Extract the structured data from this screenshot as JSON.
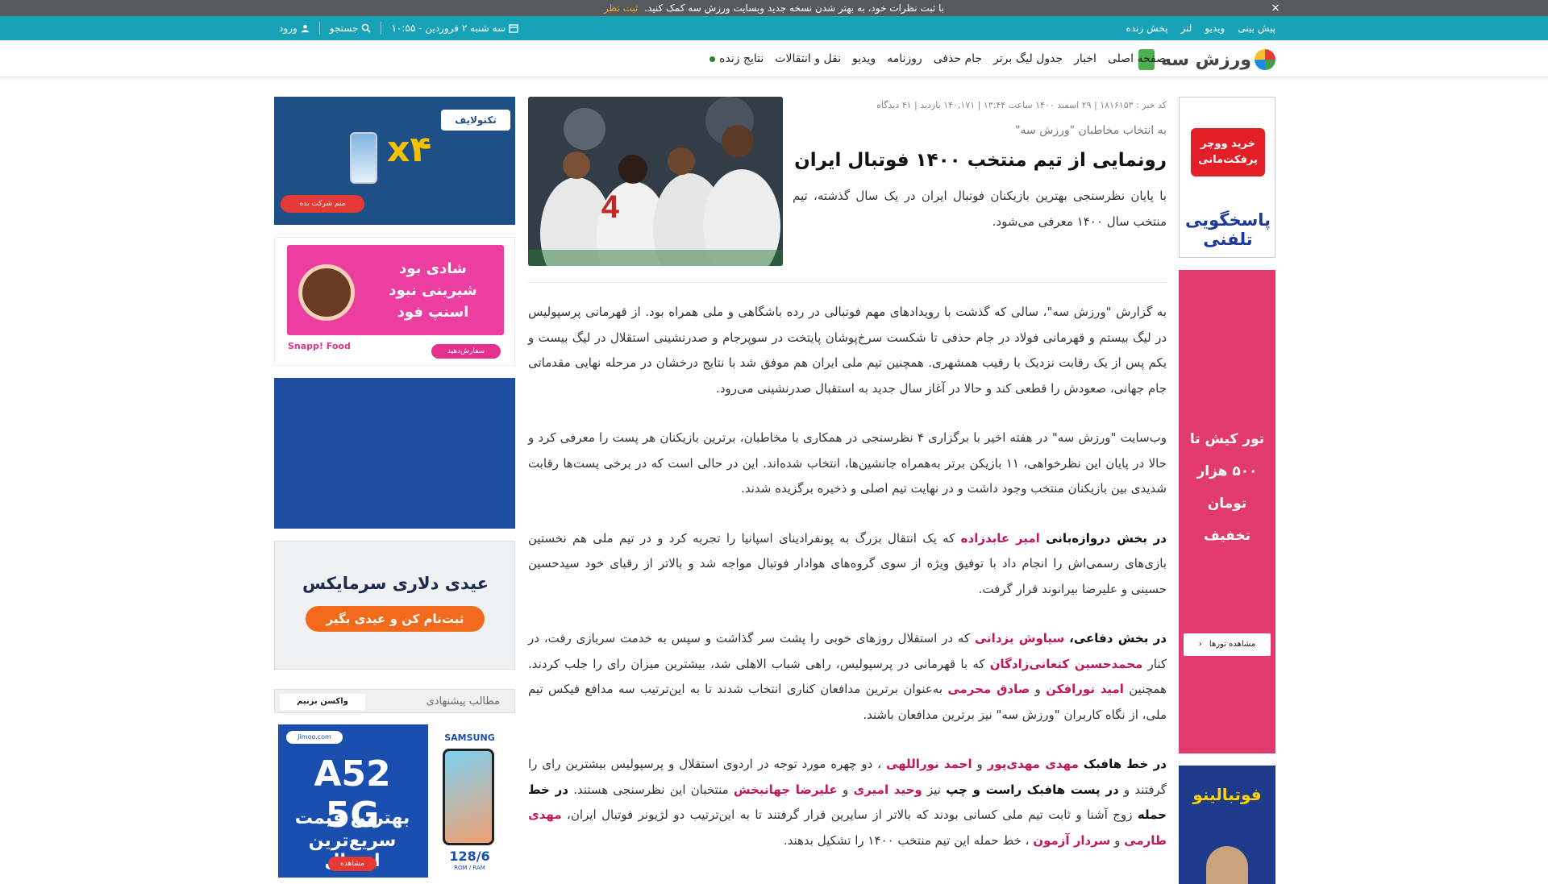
{
  "notice": {
    "text": "با ثبت نظرات خود، به بهتر شدن نسخه جدید وبسایت ورزش سه کمک کنید.",
    "link": "ثبت نظر",
    "close": "×"
  },
  "topbar": {
    "links": [
      "پیش بینی",
      "ویدیو",
      "لنز",
      "پخش زنده"
    ],
    "date": "سه شنبه ۲ فروردین - ۱۰:۵۵",
    "search": "جستجو",
    "login": "ورود"
  },
  "nav": {
    "logo": "ورزش سه",
    "items": [
      "صفحه اصلی",
      "اخبار",
      "جدول لیگ برتر",
      "جام حذفی",
      "روزنامه",
      "ویدیو",
      "نقل و انتقالات",
      "نتایج زنده"
    ]
  },
  "article": {
    "meta": "کد خبر : ۱۸۱۶۱۵۳ | ۲۹ اسفند ۱۴۰۰ ساعت ۱۳:۴۴ | ۱۴۰,۱۷۱ بازدید | ۴۱ دیدگاه",
    "kicker": "به انتخاب مخاطبان \"ورزش سه\"",
    "title": "رونمایی از تیم منتخب ۱۴۰۰ فوتبال ایران",
    "lead": "با پایان نظرسنجی بهترین بازیکنان فوتبال ایران در یک سال گذشته، تیم منتخب سال ۱۴۰۰ معرفی می‌شود.",
    "p1": "به گزارش \"ورزش سه\"، سالی که گذشت با رویدادهای مهم فوتبالی در رده باشگاهی و ملی همراه بود. از قهرمانی پرسپولیس در لیگ بیستم و قهرمانی فولاد در جام حذفی تا شکست سرخ‌پوشان پایتخت در سوپرجام و صدرنشینی استقلال در لیگ بیست و یکم پس از یک رقابت نزدیک با رقیب همشهری. همچنین تیم ملی ایران هم موفق شد با نتایج درخشان در مرحله نهایی مقدماتی جام جهانی، صعودش را قطعی کند و حالا در آغاز سال جدید به استقبال صدرنشینی می‌رود.",
    "p2": "وب‌سایت \"ورزش سه\" در هفته اخیر با برگزاری ۴ نظرسنجی در همکاری با مخاطبان، برترین بازیکنان هر پست را معرفی کرد و حالا در پایان این نظرخواهی، ۱۱ بازیکن برتر به‌همراه جانشین‌ها، انتخاب شده‌اند. این در حالی است که در برخی پست‌ها رقابت شدیدی بین بازیکنان منتخب وجود داشت و در نهایت تیم اصلی و ذخیره برگزیده شدند.",
    "p3_a": "در بخش دروازه‌بانی",
    "p3_name": "امیر عابدزاده",
    "p3_b": "که یک انتقال بزرگ به پونفرادینای اسپانیا را تجربه کرد و در تیم ملی هم نخستین بازی‌های رسمی‌اش را انجام داد با توفیق ویژه از سوی گروه‌های هوادار فوتبال مواجه شد و بالاتر از رقبای خود سیدحسین حسینی و علیرضا بیرانوند قرار گرفت.",
    "p4_a": "در بخش دفاعی،",
    "p4_n1": "سیاوش یزدانی",
    "p4_b": "که در استقلال روزهای خوبی را پشت سر گذاشت و سپس به خدمت سربازی رفت، در کنار",
    "p4_n2": "محمدحسین کنعانی‌زادگان",
    "p4_c": "که با قهرمانی در پرسپولیس، راهی شباب الاهلی شد، بیشترین میزان رای را جلب کردند. همچنین",
    "p4_n3": "امید نورافکن",
    "p4_d": "و",
    "p4_n4": "صادق محرمی",
    "p4_e": "به‌عنوان برترین مدافعان کناری انتخاب شدند تا به این‌ترتیب سه مدافع فیکس تیم ملی، از نگاه کاربران \"ورزش سه\" نیز برترین مدافعان باشند.",
    "p5_a": "در خط هافبک",
    "p5_n1": "مهدی مهدی‌پور",
    "p5_b": "و",
    "p5_n2": "احمد نوراللهی",
    "p5_c": "، دو چهره مورد توجه در اردوی استقلال و پرسپولیس بیشترین رای را گرفتند و",
    "p5_d": "در پست هافبک راست و چپ",
    "p5_e": "نیز",
    "p5_n3": "وحید امیری",
    "p5_f": "و",
    "p5_n4": "علیرضا جهانبخش",
    "p5_g": "منتخبان این نظرسنجی هستند.",
    "p5_h": "در خط حمله",
    "p5_i": "زوج آشنا و ثابت تیم ملی کسانی بودند که بالاتر از سایرین قرار گرفتند تا به این‌ترتیب دو لژیونر فوتبال ایران،",
    "p5_n5": "مهدی طارمی",
    "p5_j": "و",
    "p5_n6": "سردار آزمون",
    "p5_k": "، خط حمله این تیم منتخب ۱۴۰۰ را تشکیل بدهند."
  },
  "ads": {
    "ad1_brand": "تکنولایف",
    "ad1_big": "x۴",
    "ad1_btn": "منم شرکت بده",
    "ad2_text": "شادی بود شیرینی نبود اسنپ فود",
    "ad2_brand": "Snapp! Food",
    "ad2_btn": "سفارش‌دهید",
    "ad4_line1": "عیدی دلاری سرمایکس",
    "ad4_btn": "ثبت‌نام کن و عیدی بگیر",
    "rec_label": "مطالب پیشنهادی",
    "rec_vaxx": "واکسن بزنیم",
    "ad5_site": "Jimoo.com",
    "ad5_brand": "SAMSUNG",
    "ad5_model": "A52 5G",
    "ad5_line1": "بهترین قیمت",
    "ad5_line2": "سریع‌ترین ارسال",
    "ad5_btn": "مشاهده",
    "ad5_ram": "128/6",
    "ad5_ram_label": "ROM / RAM",
    "rad1_top": "خرید ووچر پرفکت‌مانی",
    "rad1_bottom": "پاسخگویی تلفنی",
    "rad2_text": "تور کیش تا ۵۰۰ هزار تومان تخفیف",
    "rad2_btn": "مشاهده تورها",
    "rad3_text": "فوتبالینو"
  },
  "colors": {
    "teal": "#17a2b8",
    "highlight": "#c2185b",
    "notice_bg": "#555a5f",
    "notice_link": "#f5a623"
  }
}
